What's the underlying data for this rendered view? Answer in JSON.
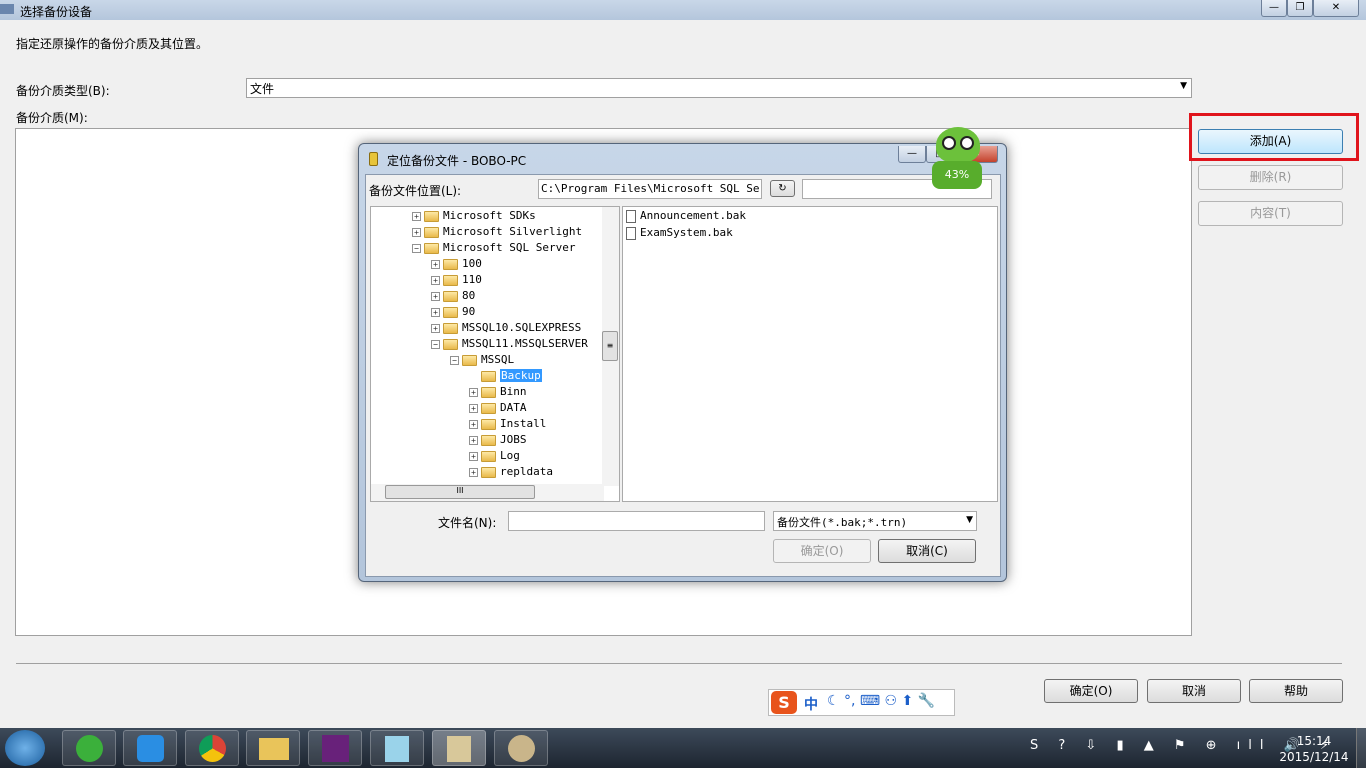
{
  "window": {
    "title": "选择备份设备",
    "instruction": "指定还原操作的备份介质及其位置。",
    "media_type_label": "备份介质类型(B):",
    "media_type_value": "文件",
    "media_label": "备份介质(M):",
    "add": "添加(A)",
    "remove": "删除(R)",
    "contents": "内容(T)",
    "ok": "确定(O)",
    "cancel": "取消",
    "help": "帮助"
  },
  "dialog": {
    "title": "定位备份文件 - BOBO-PC",
    "location_label": "备份文件位置(L):",
    "location_value": "C:\\Program Files\\Microsoft SQL Server",
    "tree": [
      {
        "label": "Microsoft SDKs",
        "level": 1,
        "exp": "+"
      },
      {
        "label": "Microsoft Silverlight",
        "level": 1,
        "exp": "+"
      },
      {
        "label": "Microsoft SQL Server",
        "level": 1,
        "exp": "-"
      },
      {
        "label": "100",
        "level": 2,
        "exp": "+"
      },
      {
        "label": "110",
        "level": 2,
        "exp": "+"
      },
      {
        "label": "80",
        "level": 2,
        "exp": "+"
      },
      {
        "label": "90",
        "level": 2,
        "exp": "+"
      },
      {
        "label": "MSSQL10.SQLEXPRESS",
        "level": 2,
        "exp": "+"
      },
      {
        "label": "MSSQL11.MSSQLSERVER",
        "level": 2,
        "exp": "-"
      },
      {
        "label": "MSSQL",
        "level": 3,
        "exp": "-"
      },
      {
        "label": "Backup",
        "level": 4,
        "exp": "",
        "selected": true
      },
      {
        "label": "Binn",
        "level": 4,
        "exp": "+"
      },
      {
        "label": "DATA",
        "level": 4,
        "exp": "+"
      },
      {
        "label": "Install",
        "level": 4,
        "exp": "+"
      },
      {
        "label": "JOBS",
        "level": 4,
        "exp": "+"
      },
      {
        "label": "Log",
        "level": 4,
        "exp": "+"
      },
      {
        "label": "repldata",
        "level": 4,
        "exp": "+"
      }
    ],
    "files": [
      "Announcement.bak",
      "ExamSystem.bak"
    ],
    "filename_label": "文件名(N):",
    "filename_value": "",
    "filter": "备份文件(*.bak;*.trn)",
    "ok": "确定(O)",
    "cancel": "取消(C)"
  },
  "overlay": {
    "percent": "43%"
  },
  "ime": {
    "mode": "中"
  },
  "taskbar": {
    "time": "15:14",
    "date": "2015/12/14"
  }
}
